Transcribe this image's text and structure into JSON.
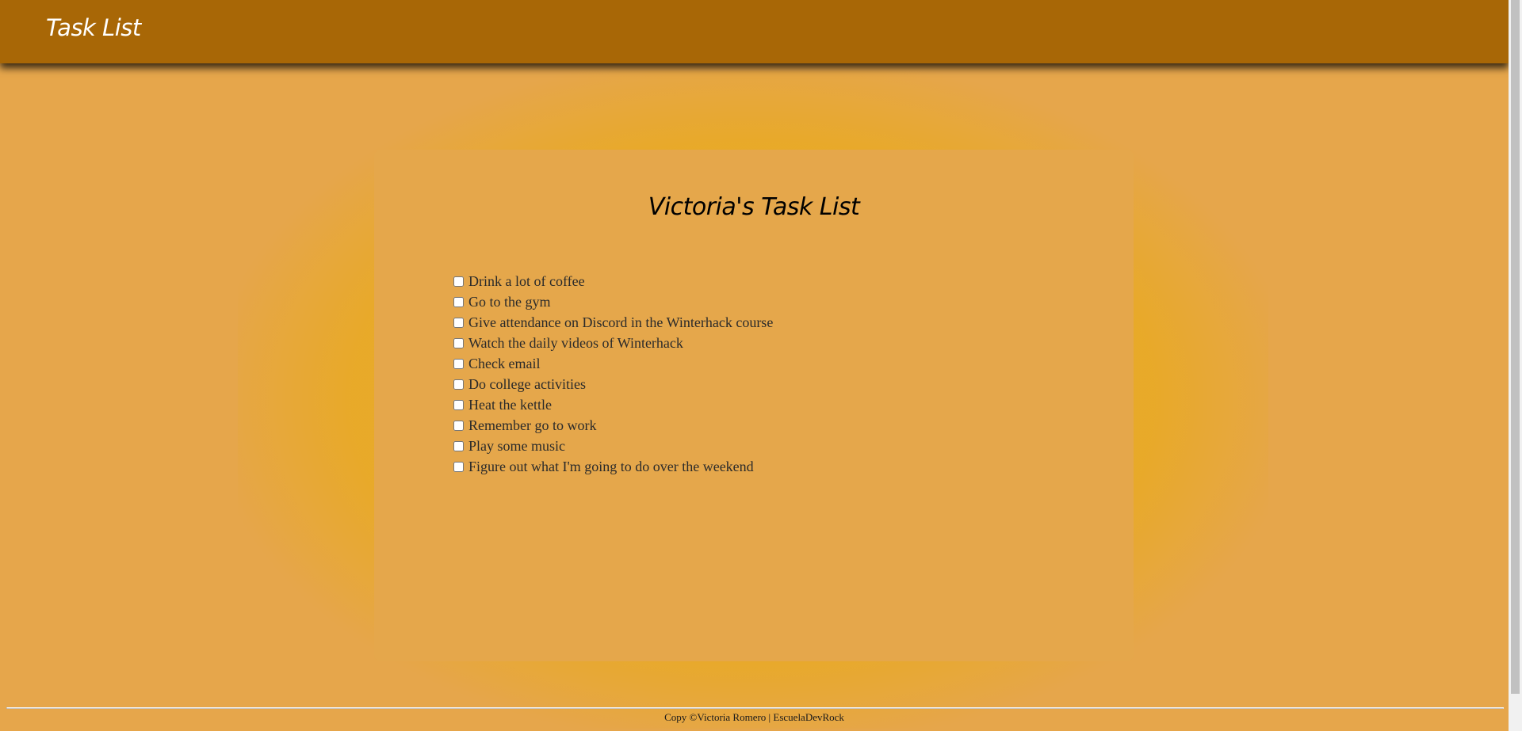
{
  "header": {
    "title": "Task List"
  },
  "card": {
    "title": "Victoria's Task List"
  },
  "tasks": [
    {
      "label": "Drink a lot of coffee",
      "checked": false
    },
    {
      "label": "Go to the gym",
      "checked": false
    },
    {
      "label": "Give attendance on Discord in the Winterhack course",
      "checked": false
    },
    {
      "label": "Watch the daily videos of Winterhack",
      "checked": false
    },
    {
      "label": "Check email",
      "checked": false
    },
    {
      "label": "Do college activities",
      "checked": false
    },
    {
      "label": "Heat the kettle",
      "checked": false
    },
    {
      "label": "Remember go to work",
      "checked": false
    },
    {
      "label": "Play some music",
      "checked": false
    },
    {
      "label": "Figure out what I'm going to do over the weekend",
      "checked": false
    }
  ],
  "footer": {
    "text": "Copy ©Victoria Romero | EscuelaDevRock"
  },
  "colors": {
    "header_bg": "#a86706",
    "page_bg": "#e6a64b",
    "card_bg": "#e5a74b",
    "glow": "#e8aa23"
  }
}
